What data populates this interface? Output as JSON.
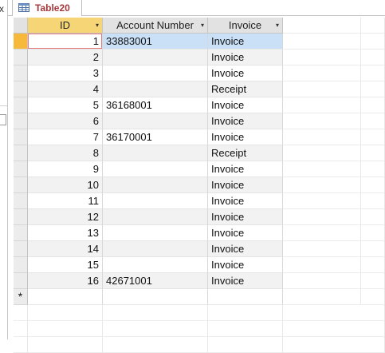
{
  "nav_pane": {
    "close_glyph": "x"
  },
  "document_tab": {
    "label": "Table20",
    "icon": "table-icon"
  },
  "table": {
    "columns": [
      {
        "label": "ID",
        "selected": true
      },
      {
        "label": "Account Number",
        "selected": false
      },
      {
        "label": "Invoice",
        "selected": false
      }
    ],
    "rows": [
      {
        "id": "1",
        "account": "33883001",
        "type": "Invoice"
      },
      {
        "id": "2",
        "account": "",
        "type": "Invoice"
      },
      {
        "id": "3",
        "account": "",
        "type": "Invoice"
      },
      {
        "id": "4",
        "account": "",
        "type": "Receipt"
      },
      {
        "id": "5",
        "account": "36168001",
        "type": "Invoice"
      },
      {
        "id": "6",
        "account": "",
        "type": "Invoice"
      },
      {
        "id": "7",
        "account": "36170001",
        "type": "Invoice"
      },
      {
        "id": "8",
        "account": "",
        "type": "Receipt"
      },
      {
        "id": "9",
        "account": "",
        "type": "Invoice"
      },
      {
        "id": "10",
        "account": "",
        "type": "Invoice"
      },
      {
        "id": "11",
        "account": "",
        "type": "Invoice"
      },
      {
        "id": "12",
        "account": "",
        "type": "Invoice"
      },
      {
        "id": "13",
        "account": "",
        "type": "Invoice"
      },
      {
        "id": "14",
        "account": "",
        "type": "Invoice"
      },
      {
        "id": "15",
        "account": "",
        "type": "Invoice"
      },
      {
        "id": "16",
        "account": "42671001",
        "type": "Invoice"
      }
    ],
    "new_row_marker": "*",
    "dropdown_glyph": "▾"
  },
  "colors": {
    "tab_label": "#a4373a",
    "header_bg": "#e2e2e2",
    "selected_header_bg": "#f6d576",
    "active_row_selector": "#f6b93b",
    "selected_row_bg": "#c9e0f7",
    "alt_row_bg": "#f2f2f2"
  }
}
